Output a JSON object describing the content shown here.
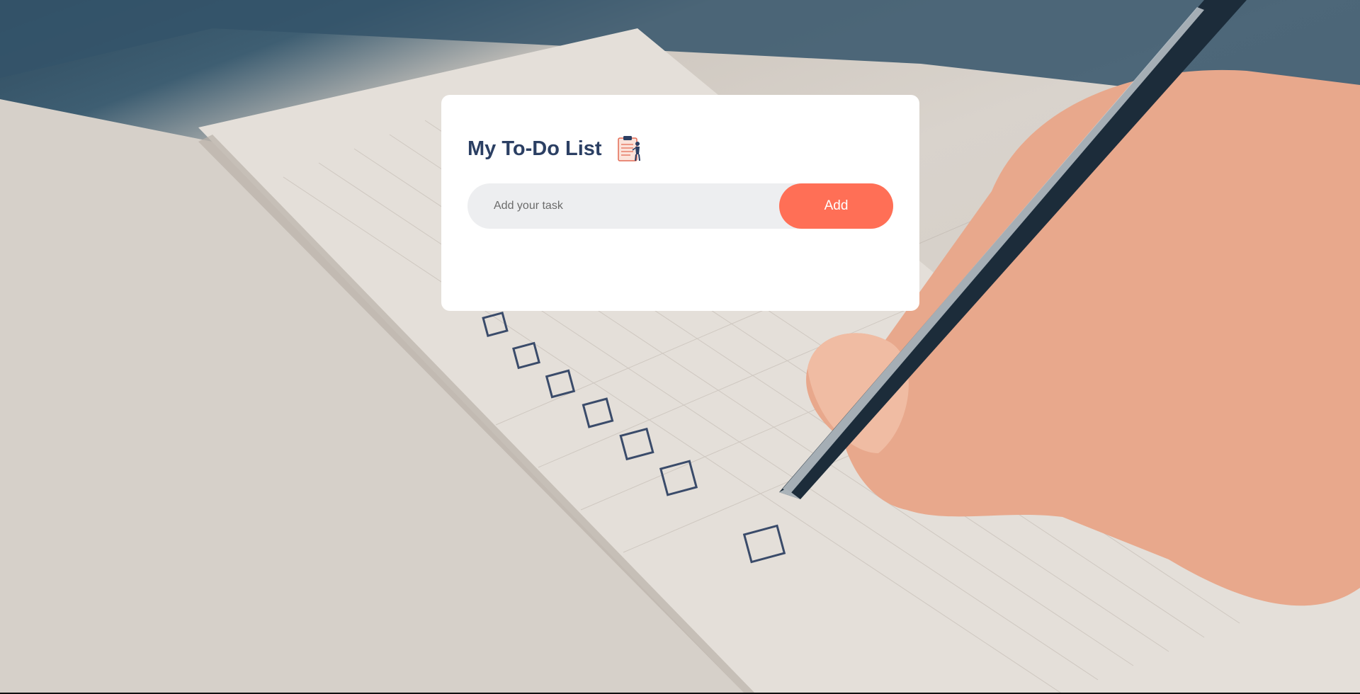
{
  "app": {
    "title": "My To-Do List",
    "title_icon": "clipboard-checklist-icon"
  },
  "task_form": {
    "input_value": "",
    "input_placeholder": "Add your task",
    "add_label": "Add"
  },
  "colors": {
    "title": "#2b3f63",
    "button": "#ff6f56",
    "input_bg": "#edeef0",
    "card_bg": "#ffffff"
  },
  "background": {
    "description_icon": "notebook-checklist-photo"
  }
}
